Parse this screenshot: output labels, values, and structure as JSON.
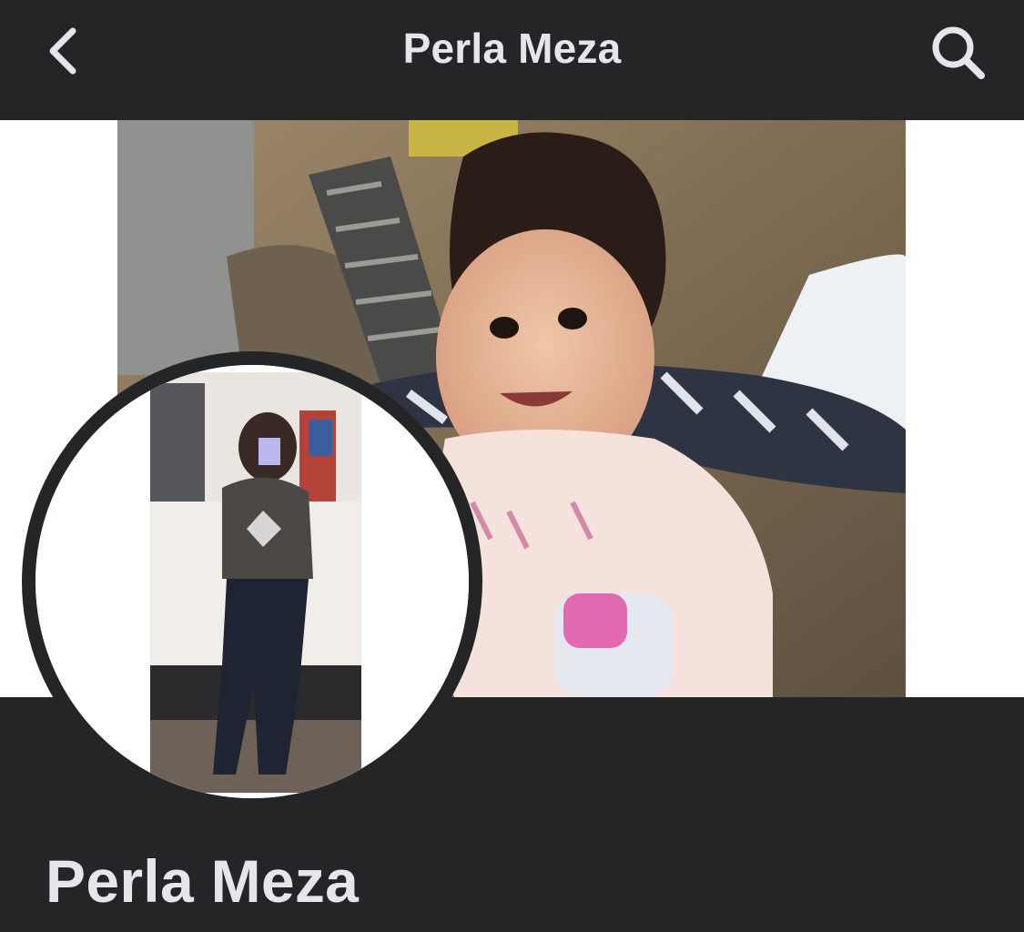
{
  "topbar": {
    "title": "Perla Meza",
    "back_icon": "chevron-left-icon",
    "search_icon": "search-icon"
  },
  "cover": {
    "description_icon": "cover-photo"
  },
  "profile": {
    "name": "Perla Meza"
  },
  "colors": {
    "bar_background": "#242526",
    "text_primary": "#e4e6eb",
    "cover_side_background": "#ffffff"
  }
}
